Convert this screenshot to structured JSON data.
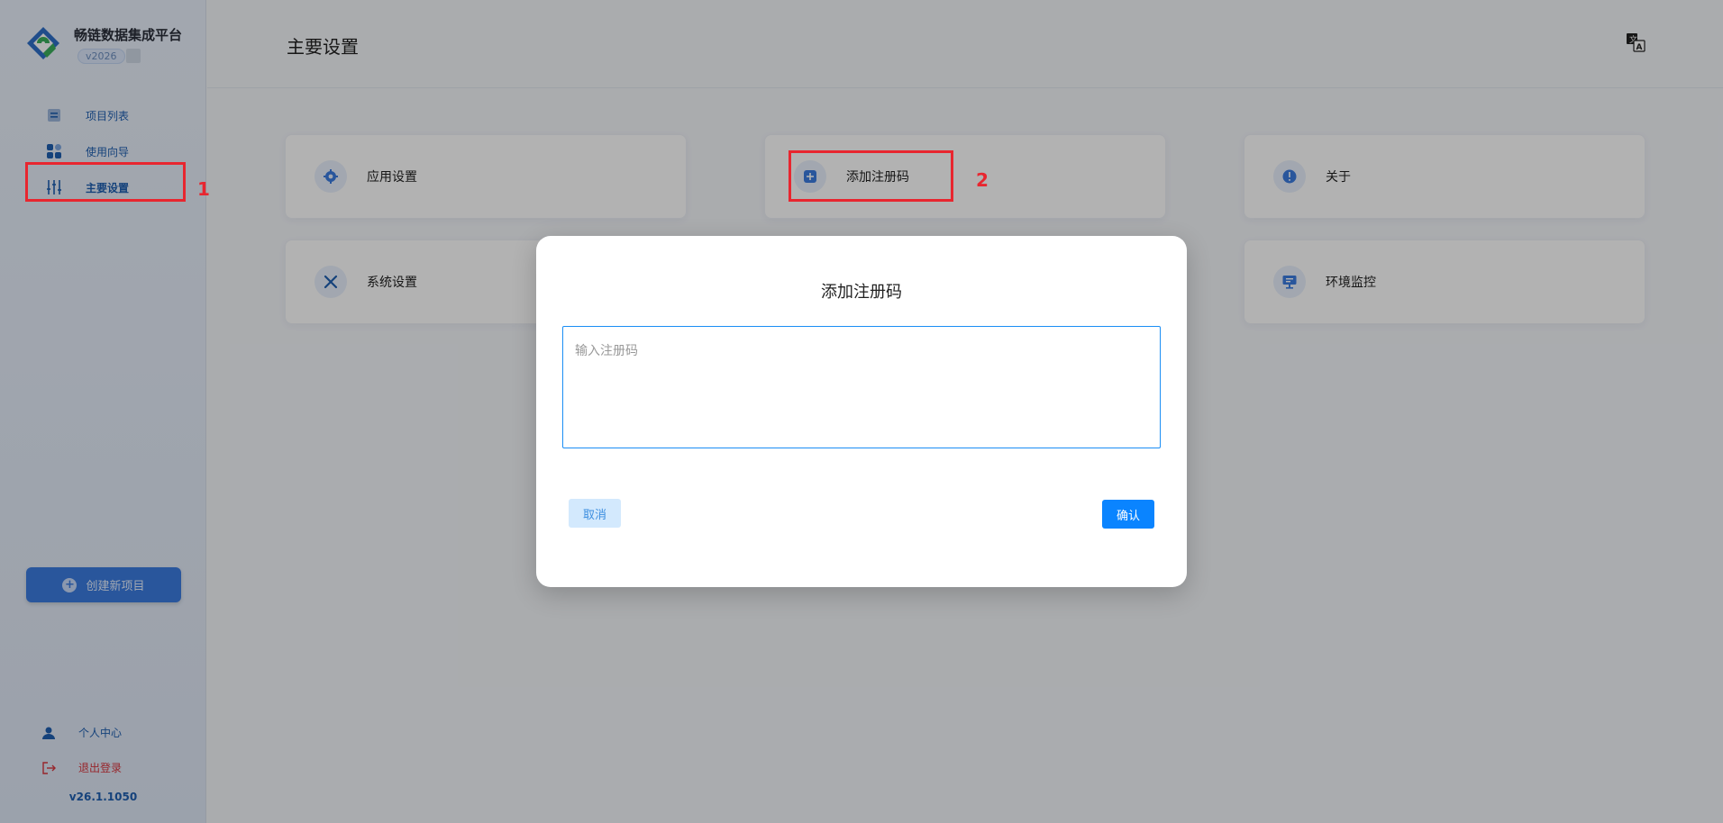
{
  "app": {
    "name": "畅链数据集成平台",
    "version_badge": "v2026",
    "footer_version": "v26.1.1050"
  },
  "sidebar": {
    "items": [
      {
        "label": "项目列表",
        "icon": "project-list-icon"
      },
      {
        "label": "使用向导",
        "icon": "guide-grid-icon"
      },
      {
        "label": "主要设置",
        "icon": "sliders-icon",
        "active": true
      }
    ],
    "create_button": "创建新项目",
    "bottom": [
      {
        "label": "个人中心",
        "icon": "user-icon"
      },
      {
        "label": "退出登录",
        "icon": "logout-icon"
      }
    ]
  },
  "header": {
    "title": "主要设置",
    "lang_icon": "translate-icon"
  },
  "cards": [
    {
      "label": "应用设置",
      "icon": "gear-icon"
    },
    {
      "label": "添加注册码",
      "icon": "add-icon"
    },
    {
      "label": "关于",
      "icon": "info-icon"
    },
    {
      "label": "系统设置",
      "icon": "tools-icon"
    },
    {
      "label": "环境监控",
      "icon": "monitor-icon"
    }
  ],
  "dialog": {
    "title": "添加注册码",
    "placeholder": "输入注册码",
    "cancel": "取消",
    "confirm": "确认"
  },
  "annotations": [
    "1",
    "2"
  ],
  "colors": {
    "accent": "#0a84ff",
    "sidebar_text": "#1f5fb0",
    "danger": "#d9363e",
    "marker": "#e8262f"
  }
}
